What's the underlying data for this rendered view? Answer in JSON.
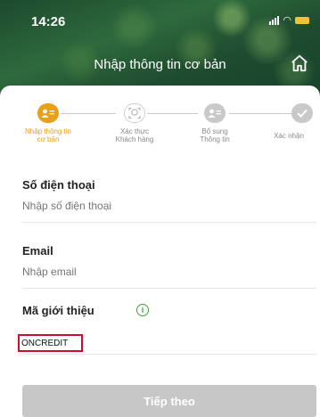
{
  "status_bar": {
    "time": "14:26"
  },
  "header": {
    "title": "Nhập thông tin cơ bản",
    "home_icon": "home-icon"
  },
  "stepper": {
    "steps": [
      {
        "label_line1": "Nhập thông tin",
        "label_line2": "cơ bản",
        "state": "active",
        "icon": "person-card-icon"
      },
      {
        "label_line1": "Xác thực",
        "label_line2": "Khách hàng",
        "state": "pending",
        "icon": "face-verify-icon"
      },
      {
        "label_line1": "Bổ sung",
        "label_line2": "Thông tin",
        "state": "pending",
        "icon": "person-card-icon"
      },
      {
        "label_line1": "Xác nhận",
        "label_line2": "",
        "state": "pending",
        "icon": "check-icon"
      }
    ],
    "active_color": "#e8a018",
    "inactive_color": "#c9c9c9"
  },
  "form": {
    "phone": {
      "label": "Số điện thoại",
      "placeholder": "Nhập số điện thoại",
      "value": ""
    },
    "email": {
      "label": "Email",
      "placeholder": "Nhập email",
      "value": ""
    },
    "referral": {
      "label": "Mã giới thiệu",
      "value": "ONCREDIT",
      "info_icon": "info-icon"
    }
  },
  "actions": {
    "next_label": "Tiếp theo"
  },
  "colors": {
    "brand_green": "#2e6a3c",
    "accent": "#e8a018",
    "highlight_border": "#c8102e",
    "disabled_button": "#c7c7c7"
  }
}
